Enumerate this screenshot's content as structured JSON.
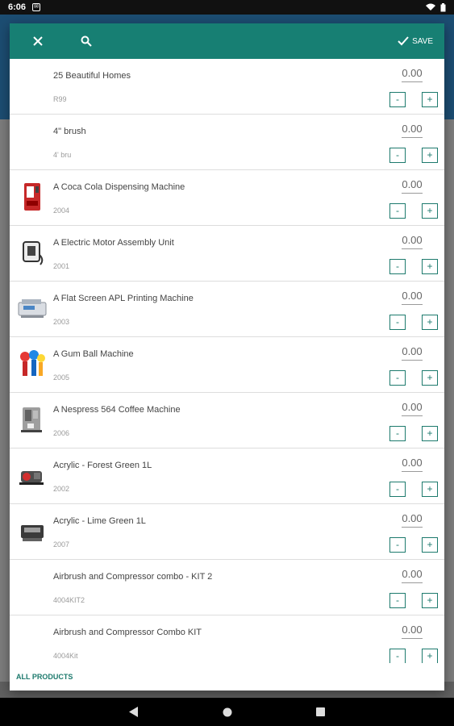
{
  "status_bar": {
    "time": "6:06"
  },
  "toolbar": {
    "save_label": "SAVE"
  },
  "items": [
    {
      "name": "25 Beautiful Homes",
      "sku": "R99",
      "qty": "0.00",
      "image": ""
    },
    {
      "name": "4\" brush",
      "sku": "4' bru",
      "qty": "0.00",
      "image": ""
    },
    {
      "name": "A Coca Cola Dispensing Machine",
      "sku": "2004",
      "qty": "0.00",
      "image": "vending-machine-icon"
    },
    {
      "name": "A Electric Motor Assembly Unit",
      "sku": "2001",
      "qty": "0.00",
      "image": "motor-unit-icon"
    },
    {
      "name": "A Flat Screen APL Printing Machine",
      "sku": "2003",
      "qty": "0.00",
      "image": "printer-machine-icon"
    },
    {
      "name": "A Gum Ball Machine",
      "sku": "2005",
      "qty": "0.00",
      "image": "gumball-machine-icon"
    },
    {
      "name": "A Nespress 564 Coffee Machine",
      "sku": "2006",
      "qty": "0.00",
      "image": "coffee-machine-icon"
    },
    {
      "name": "Acrylic - Forest Green 1L",
      "sku": "2002",
      "qty": "0.00",
      "image": "paint-machine-icon"
    },
    {
      "name": "Acrylic - Lime Green 1L",
      "sku": "2007",
      "qty": "0.00",
      "image": "paint-machine-icon"
    },
    {
      "name": "Airbrush and Compressor combo - KIT 2",
      "sku": "4004KIT2",
      "qty": "0.00",
      "image": ""
    },
    {
      "name": "Airbrush and Compressor Combo KIT",
      "sku": "4004Kit",
      "qty": "0.00",
      "image": ""
    }
  ],
  "buttons": {
    "minus": "-",
    "plus": "+"
  },
  "footer": {
    "all_products_label": "ALL PRODUCTS"
  },
  "colors": {
    "accent": "#177f73",
    "button_border": "#1d7a6d"
  }
}
